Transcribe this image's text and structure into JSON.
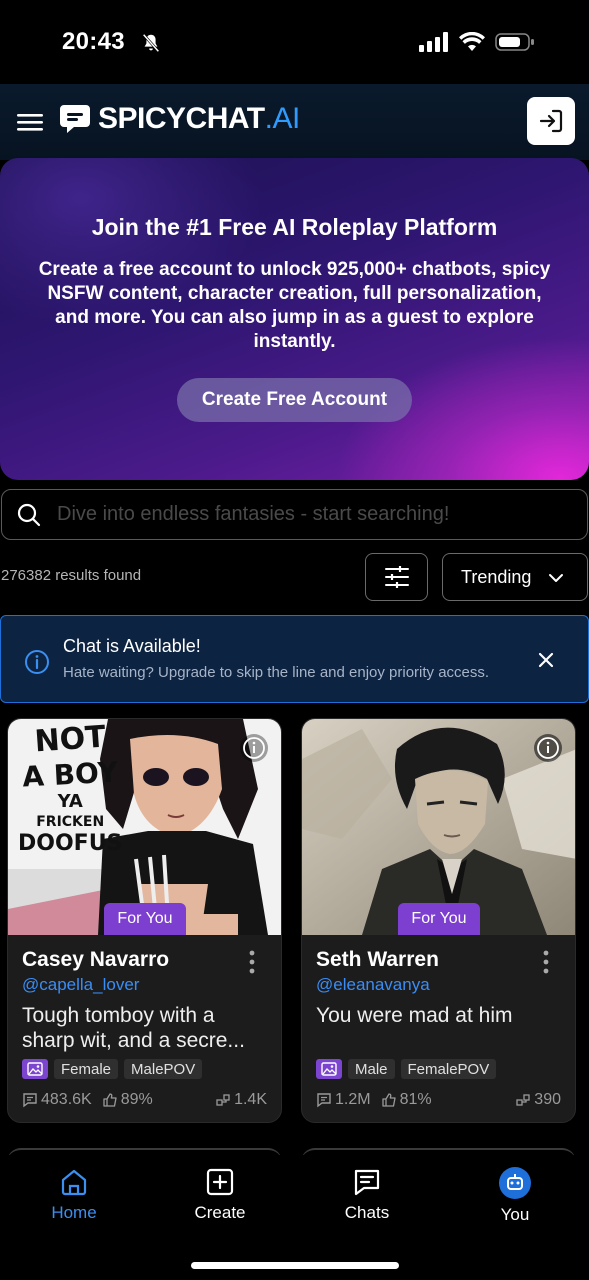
{
  "status_bar": {
    "time": "20:43"
  },
  "header": {
    "logo_main": "SPICYCHAT",
    "logo_suffix": ".AI"
  },
  "hero": {
    "title": "Join the #1 Free AI Roleplay Platform",
    "text": "Create a free account to unlock 925,000+ chatbots, spicy NSFW content, character creation, full personalization, and more. You can also jump in as a guest to explore instantly.",
    "button_label": "Create Free Account"
  },
  "search": {
    "placeholder": "Dive into endless fantasies - start searching!"
  },
  "results": {
    "count_text": "276382 results found",
    "sort_label": "Trending"
  },
  "alert": {
    "title": "Chat is Available!",
    "text": "Hate waiting? Upgrade to skip the line and enjoy priority access."
  },
  "cards": [
    {
      "badge": "For You",
      "name": "Casey Navarro",
      "user": "@capella_lover",
      "desc": "Tough tomboy with a sharp wit, and a secre...",
      "tags": [
        "Female",
        "MalePOV"
      ],
      "messages": "483.6K",
      "likes": "89%",
      "bots": "1.4K",
      "image_text": [
        "NOT",
        "A BOY",
        "YA",
        "FRICKEN",
        "DOOFUS"
      ]
    },
    {
      "badge": "For You",
      "name": "Seth Warren",
      "user": "@eleanavanya",
      "desc": "You were mad at him",
      "tags": [
        "Male",
        "FemalePOV"
      ],
      "messages": "1.2M",
      "likes": "81%",
      "bots": "390"
    }
  ],
  "tabbar": {
    "home": "Home",
    "create": "Create",
    "chats": "Chats",
    "you": "You"
  },
  "colors": {
    "accent_blue": "#3b8ff0",
    "badge_purple": "#7d3fcf",
    "alert_bg": "#0d2342"
  }
}
